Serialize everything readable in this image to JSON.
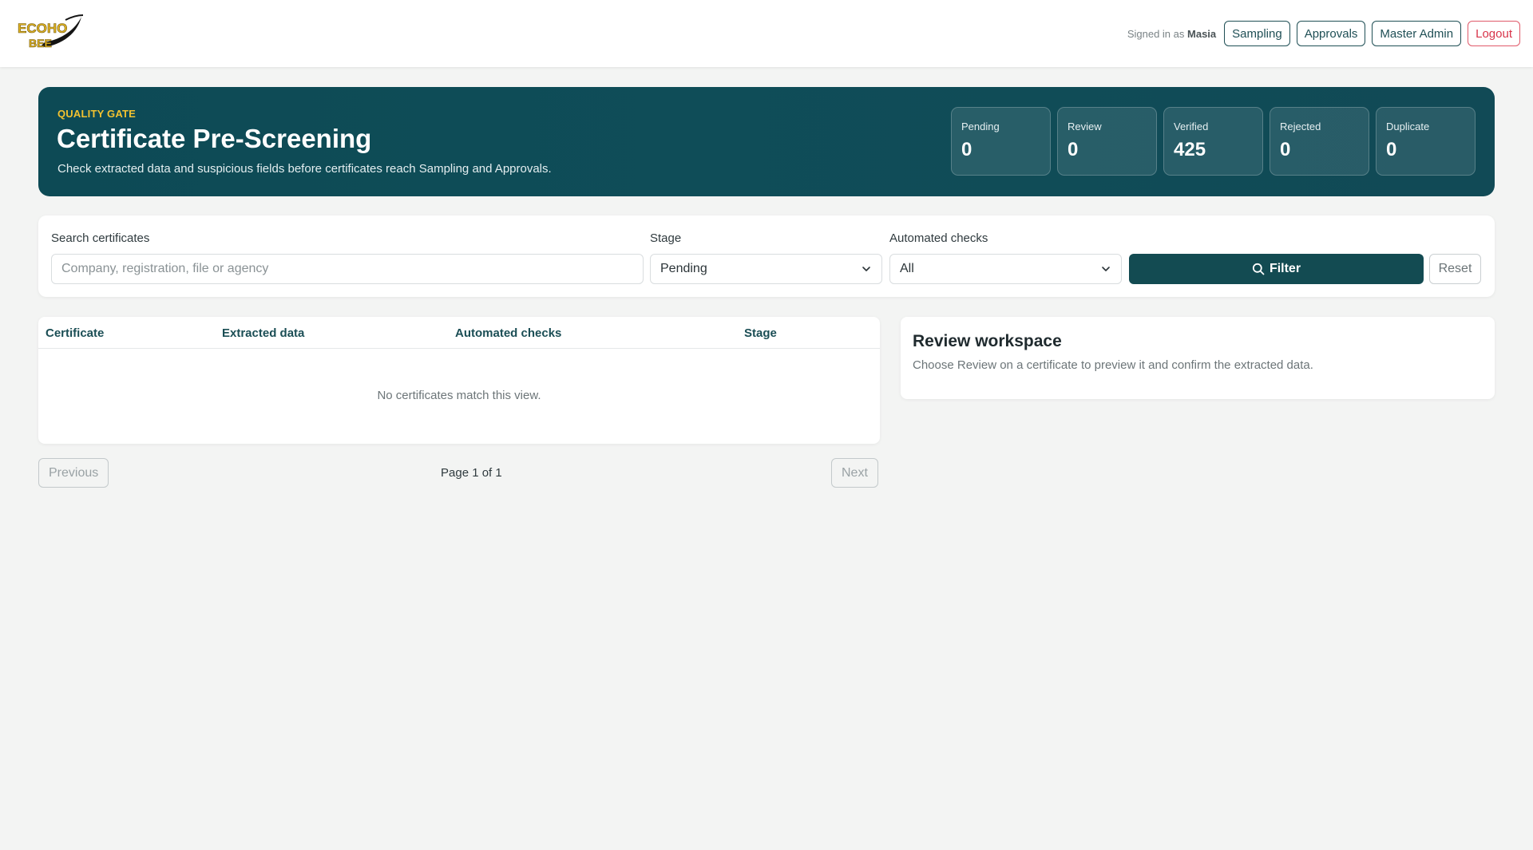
{
  "navbar": {
    "logo_line1": "ECOHO",
    "logo_line2": "BEE",
    "signed_in_prefix": "Signed in as",
    "signed_in_user": "Masia",
    "buttons": {
      "sampling": "Sampling",
      "approvals": "Approvals",
      "master_admin": "Master Admin",
      "logout": "Logout"
    }
  },
  "hero": {
    "eyebrow": "QUALITY GATE",
    "title": "Certificate Pre-Screening",
    "subtitle": "Check extracted data and suspicious fields before certificates reach Sampling and Approvals.",
    "stats": [
      {
        "label": "Pending",
        "value": "0"
      },
      {
        "label": "Review",
        "value": "0"
      },
      {
        "label": "Verified",
        "value": "425"
      },
      {
        "label": "Rejected",
        "value": "0"
      },
      {
        "label": "Duplicate",
        "value": "0"
      }
    ]
  },
  "filters": {
    "search_label": "Search certificates",
    "search_placeholder": "Company, registration, file or agency",
    "search_value": "",
    "stage_label": "Stage",
    "stage_value": "Pending",
    "checks_label": "Automated checks",
    "checks_value": "All",
    "filter_button": "Filter",
    "reset_button": "Reset"
  },
  "table": {
    "columns": [
      "Certificate",
      "Extracted data",
      "Automated checks",
      "Stage"
    ],
    "empty_message": "No certificates match this view."
  },
  "pagination": {
    "previous": "Previous",
    "page_text": "Page 1 of 1",
    "next": "Next"
  },
  "review": {
    "title": "Review workspace",
    "subtitle": "Choose Review on a certificate to preview it and confirm the extracted data."
  },
  "colors": {
    "primary": "#134b52",
    "hero_bg": "#0f4d58",
    "accent_yellow": "#f2c230",
    "logout_red": "#d8344a",
    "page_bg": "#f3f4f3"
  }
}
